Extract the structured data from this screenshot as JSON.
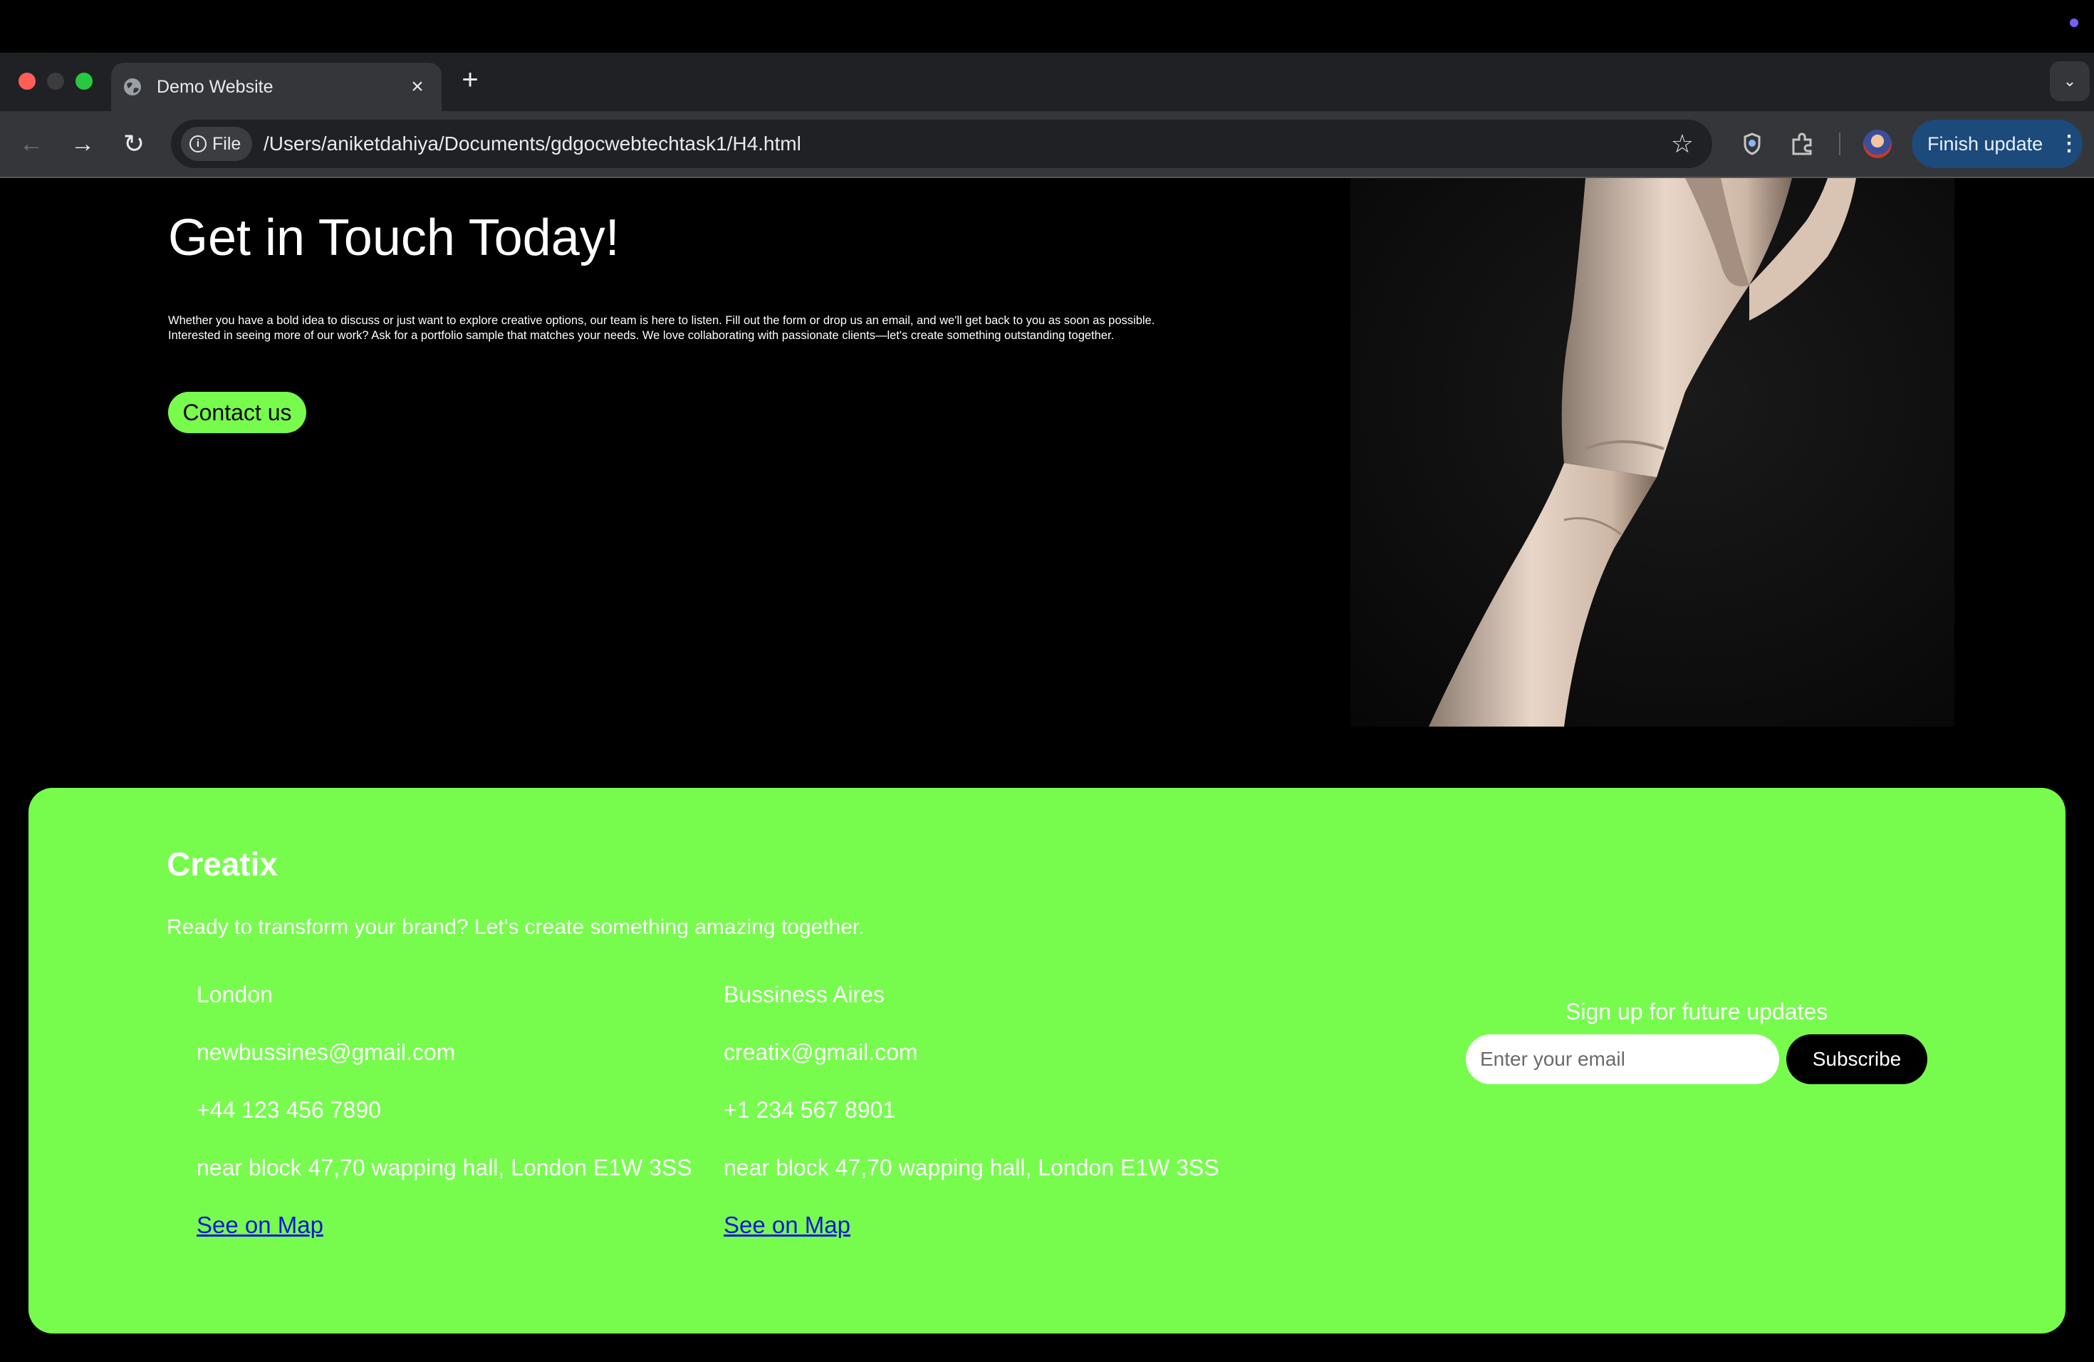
{
  "browser": {
    "tab": {
      "title": "Demo Website",
      "close_icon": "×"
    },
    "new_tab_icon": "+",
    "tab_dropdown_icon": "⌄",
    "chip_label": "File",
    "url": "/Users/aniketdahiya/Documents/gdgocwebtechtask1/H4.html",
    "finish_update_label": "Finish update",
    "colors": {
      "accent_update": "#1c4a7a",
      "toolbar": "#35363a",
      "tabstrip": "#202124"
    }
  },
  "page": {
    "hero": {
      "title": "Get in Touch Today!",
      "text": "Whether you have a bold idea to discuss or just want to explore creative options, our team is here to listen. Fill out the form or drop us an email, and we'll get back to you as soon as possible. Interested in seeing more of our work? Ask for a portfolio sample that matches your needs. We love collaborating with passionate clients—let's create something outstanding together.",
      "button_label": "Contact us"
    },
    "footer": {
      "brand": "Creatix",
      "tagline": "Ready to transform your brand? Let's create something amazing together.",
      "offices": [
        {
          "city": "London",
          "email": "newbussines@gmail.com",
          "phone": "+44 123 456 7890",
          "address": "near block 47,70 wapping hall, London E1W 3SS",
          "map_link": "See on Map"
        },
        {
          "city": "Bussiness Aires",
          "email": "creatix@gmail.com",
          "phone": "+1 234 567 8901",
          "address": "near block 47,70 wapping hall, London E1W 3SS",
          "map_link": "See on Map"
        }
      ],
      "signup": {
        "label": "Sign up for future updates",
        "placeholder": "Enter your email",
        "button_label": "Subscribe"
      }
    },
    "colors": {
      "accent_green": "#77fc4e",
      "background": "#000000",
      "link": "#0d18d6"
    }
  }
}
